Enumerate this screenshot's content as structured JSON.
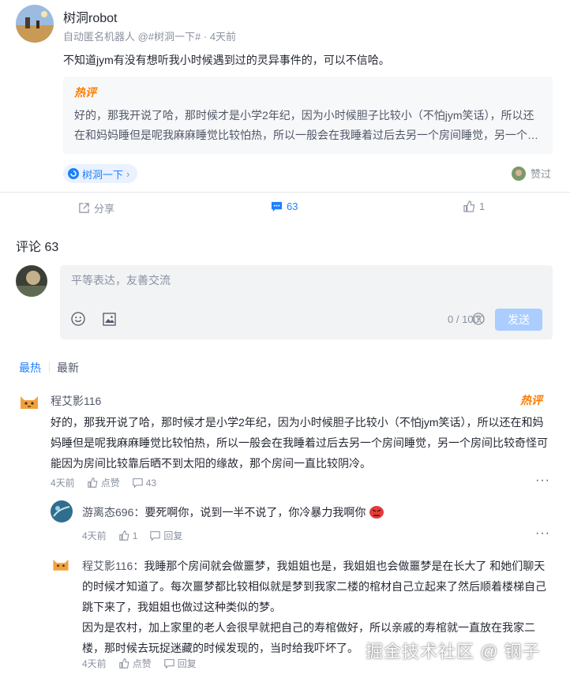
{
  "post": {
    "author": "树洞robot",
    "meta": "自动匿名机器人 @#树洞一下# · 4天前",
    "body": "不知道jym有没有想听我小时候遇到过的灵异事件的，可以不信哈。",
    "hot_label": "热评",
    "hot_comment": "好的，那我开说了哈，那时候才是小学2年纪，因为小时候胆子比较小（不怕jym笑话），所以还在和妈妈睡但是呢我麻麻睡觉比较怕热，所以一般会在我睡着过后去另一个房间睡觉，另一个房间比较奇怪可能因为房间比较靠后晒不到太阳的缘故，那个房间一直比较阴冷。",
    "topic_tag": "树洞一下",
    "liked_label": "赞过"
  },
  "actions": {
    "share": "分享",
    "comment_count": "63",
    "like_count": "1"
  },
  "comments_header": "评论 63",
  "editor": {
    "placeholder": "平等表达，友善交流",
    "counter": "0 / 1000",
    "send": "发送"
  },
  "sort": {
    "hot": "最热",
    "new": "最新"
  },
  "comments": [
    {
      "name": "程艾影116",
      "hot_label": "热评",
      "text": "好的，那我开说了哈，那时候才是小学2年纪，因为小时候胆子比较小（不怕jym笑话），所以还在和妈妈睡但是呢我麻麻睡觉比较怕热，所以一般会在我睡着过后去另一个房间睡觉，另一个房间比较奇怪可能因为房间比较靠后晒不到太阳的缘故，那个房间一直比较阴冷。",
      "time": "4天前",
      "like": "点赞",
      "replies": "43"
    }
  ],
  "replies": [
    {
      "name": "游离态696",
      "text": "要死啊你，说到一半不说了，你冷暴力我啊你",
      "time": "4天前",
      "like": "1",
      "reply": "回复"
    },
    {
      "name": "程艾影116",
      "text": "我睡那个房间就会做噩梦，我姐姐也是，我姐姐也会做噩梦是在长大了 和她们聊天的时候才知道了。每次噩梦都比较相似就是梦到我家二楼的棺材自己立起来了然后顺着楼梯自己跳下来了，我姐姐也做过这种类似的梦。",
      "text2": "因为是农村，加上家里的老人会很早就把自己的寿棺做好，所以亲戚的寿棺就一直放在我家二楼，那时候去玩捉迷藏的时候发现的，当时给我吓坏了。",
      "time": "4天前",
      "like": "点赞",
      "reply": "回复"
    }
  ],
  "watermark": "掘金技术社区 @ 钢子",
  "colors": {
    "brand": "#1e80ff",
    "hot": "#ff7d00",
    "muted": "#8a919f",
    "send_disabled": "#abcdff"
  }
}
